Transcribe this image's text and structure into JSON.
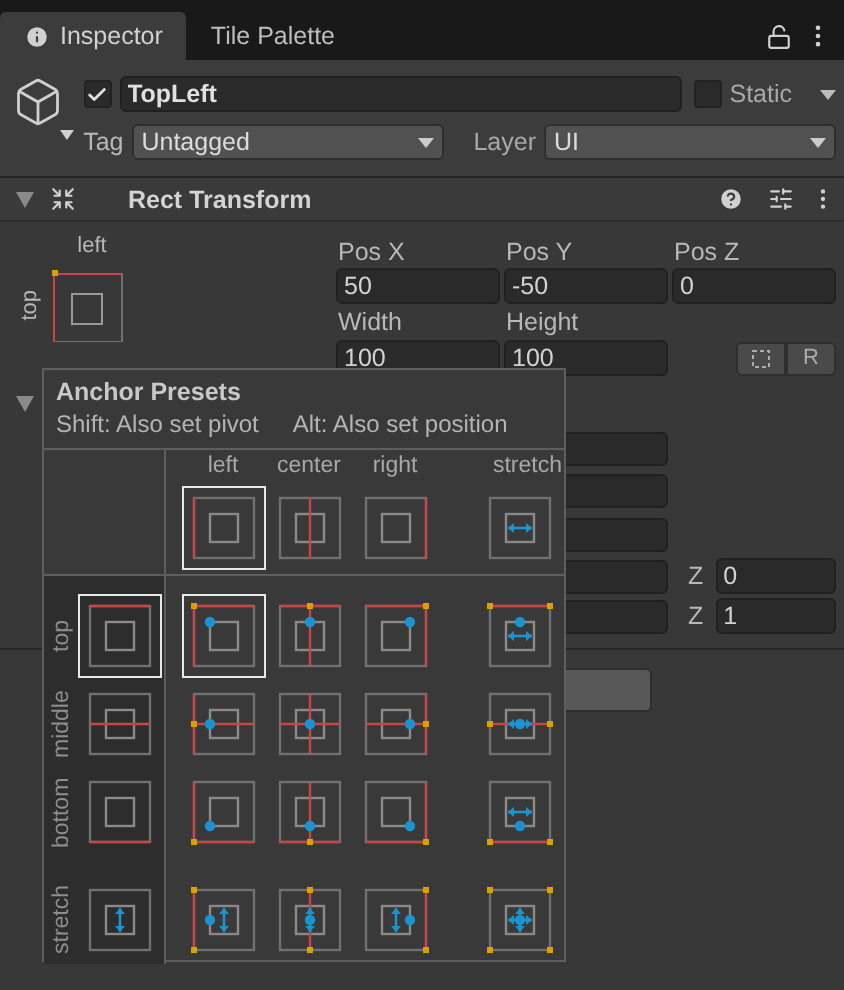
{
  "tabs": [
    {
      "label": "Inspector",
      "selected": true
    },
    {
      "label": "Tile Palette",
      "selected": false
    }
  ],
  "object": {
    "active": true,
    "name": "TopLeft",
    "static": false,
    "static_label": "Static",
    "tag_label": "Tag",
    "tag": "Untagged",
    "layer_label": "Layer",
    "layer": "UI"
  },
  "component": {
    "title": "Rect Transform",
    "expanded": true,
    "anchor_h_label": "left",
    "anchor_v_label": "top",
    "fields": [
      {
        "label": "Pos X",
        "value": "50"
      },
      {
        "label": "Pos Y",
        "value": "-50"
      },
      {
        "label": "Pos Z",
        "value": "0"
      },
      {
        "label": "Width",
        "value": "100"
      },
      {
        "label": "Height",
        "value": "100"
      }
    ],
    "raw_button": "R",
    "z_fields": [
      {
        "label": "Z",
        "value": "0"
      },
      {
        "label": "Z",
        "value": "1"
      }
    ]
  },
  "anchor_presets": {
    "title": "Anchor Presets",
    "hint_pivot": "Shift: Also set pivot",
    "hint_position": "Alt: Also set position",
    "columns": [
      {
        "label": "left",
        "kind": "left",
        "selected": true
      },
      {
        "label": "center",
        "kind": "center",
        "selected": false
      },
      {
        "label": "right",
        "kind": "right",
        "selected": false
      },
      {
        "label": "stretch",
        "kind": "stretch",
        "selected": false
      }
    ],
    "rows": [
      {
        "label": "top",
        "kind": "top",
        "selected": true,
        "cells": [
          {
            "selected": true
          },
          {
            "selected": false
          },
          {
            "selected": false
          },
          {
            "selected": false
          }
        ]
      },
      {
        "label": "middle",
        "kind": "middle",
        "selected": false,
        "cells": [
          {
            "selected": false
          },
          {
            "selected": false
          },
          {
            "selected": false
          },
          {
            "selected": false
          }
        ]
      },
      {
        "label": "bottom",
        "kind": "bottom",
        "selected": false,
        "cells": [
          {
            "selected": false
          },
          {
            "selected": false
          },
          {
            "selected": false
          },
          {
            "selected": false
          }
        ]
      },
      {
        "label": "stretch",
        "kind": "stretch",
        "selected": false,
        "cells": [
          {
            "selected": false
          },
          {
            "selected": false
          },
          {
            "selected": false
          },
          {
            "selected": false
          }
        ]
      }
    ]
  }
}
